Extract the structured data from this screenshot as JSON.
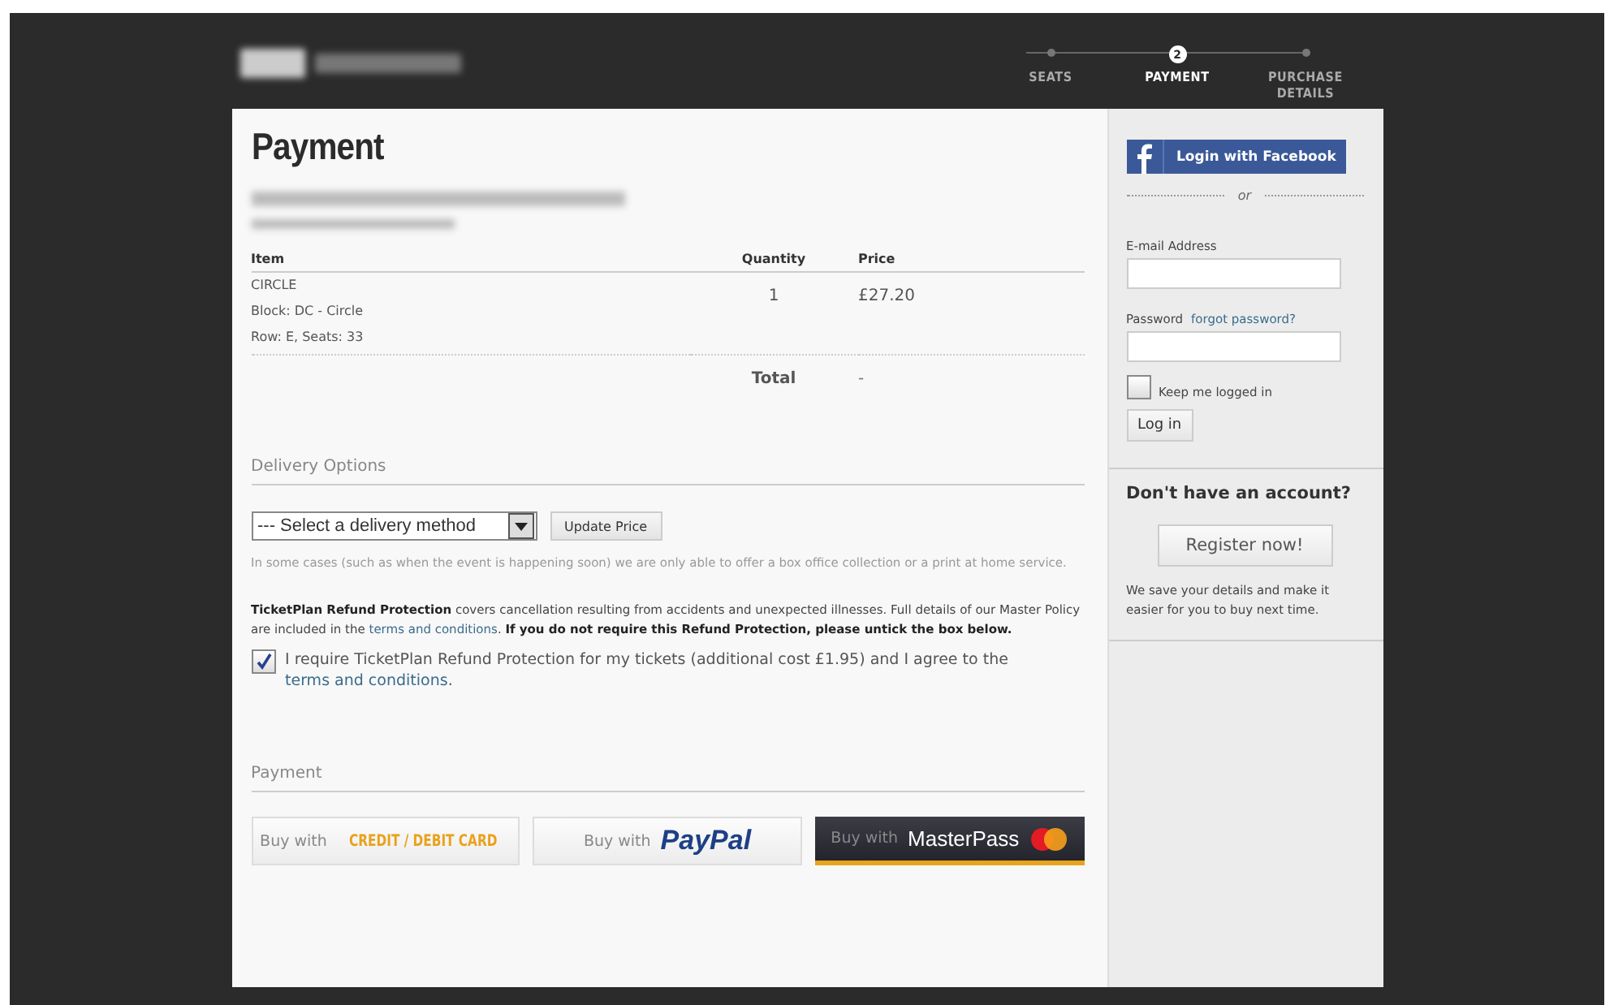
{
  "header": {
    "steps": [
      {
        "label": "SEATS",
        "selected": false
      },
      {
        "label": "PAYMENT",
        "selected": true,
        "number": "2"
      },
      {
        "label": "PURCHASE DETAILS",
        "selected": false
      }
    ]
  },
  "main": {
    "title": "Payment",
    "table": {
      "columns": [
        "Item",
        "Quantity",
        "Price"
      ],
      "rows": [
        {
          "item_lines": [
            "CIRCLE",
            "Block: DC - Circle",
            "Row: E, Seats: 33"
          ],
          "quantity": "1",
          "price": "£27.20"
        }
      ],
      "total": {
        "label": "Total",
        "value": "-"
      }
    },
    "delivery": {
      "heading": "Delivery Options",
      "select_value": "--- Select a delivery method",
      "button": "Update Price",
      "note": "In some cases (such as when the event is happening soon) we are only able to offer a box office collection or a print at home service."
    },
    "refund": {
      "before_link": "**TicketPlan Refund Protection** covers cancellation resulting from accidents and unexpected illnesses. Full details of our Master Policy are included in the ",
      "link": "terms and conditions",
      "after_link": ". **If you do not require this Refund Protection, please untick the box below.**",
      "checkbox": {
        "checked": true,
        "label": "I require TicketPlan Refund Protection for my tickets (additional cost £1.95) and I agree to the ",
        "link": "terms and conditions",
        "after_link": "."
      }
    },
    "payment": {
      "heading": "Payment",
      "buttons": [
        {
          "kind": "card",
          "prefix": "Buy with",
          "brand": "CREDIT / DEBIT CARD"
        },
        {
          "kind": "paypal",
          "prefix": "Buy with",
          "brand": "PayPal"
        },
        {
          "kind": "masterpass",
          "prefix": "Buy with",
          "brand": "MasterPass"
        }
      ]
    }
  },
  "sidebar": {
    "facebook_button": "Login with Facebook",
    "or": "or",
    "email_label": "E-mail Address",
    "password_label": "Password",
    "forgot_link": "forgot password?",
    "keep_logged_in": {
      "label": "Keep me logged in",
      "checked": false
    },
    "login_button": "Log in",
    "register": {
      "heading": "Don't have an account?",
      "button": "Register now!",
      "note": "We save your details and make it easier for you to buy next time."
    }
  }
}
